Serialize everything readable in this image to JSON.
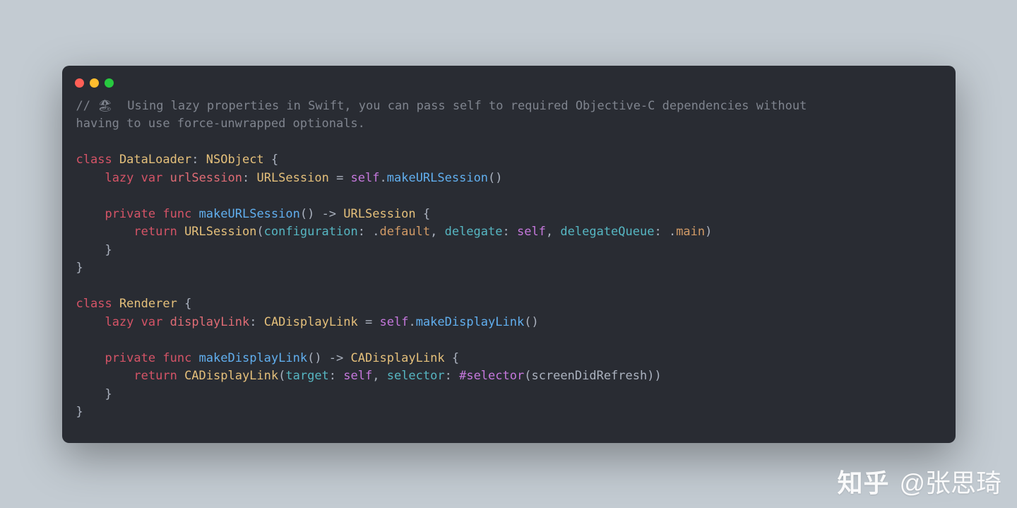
{
  "comment_line1": "// 🏖  Using lazy properties in Swift, you can pass self to required Objective-C dependencies without ",
  "comment_line2": "having to use force-unwrapped optionals.",
  "kw_class": "class",
  "kw_lazy": "lazy",
  "kw_var": "var",
  "kw_private": "private",
  "kw_func": "func",
  "kw_return": "return",
  "kw_self": "self",
  "kw_selector": "#selector",
  "cls_DataLoader": "DataLoader",
  "cls_NSObject": "NSObject",
  "cls_URLSession": "URLSession",
  "cls_Renderer": "Renderer",
  "cls_CADisplayLink": "CADisplayLink",
  "prop_urlSession": "urlSession",
  "prop_displayLink": "displayLink",
  "fn_makeURLSession": "makeURLSession",
  "fn_makeDisplayLink": "makeDisplayLink",
  "fn_screenDidRefresh": "screenDidRefresh",
  "lbl_configuration": "configuration",
  "lbl_delegate": "delegate",
  "lbl_delegateQueue": "delegateQueue",
  "lbl_target": "target",
  "lbl_selector": "selector",
  "val_default": "default",
  "val_main": "main",
  "watermark_logo": "知乎",
  "watermark_at": "@张思琦"
}
